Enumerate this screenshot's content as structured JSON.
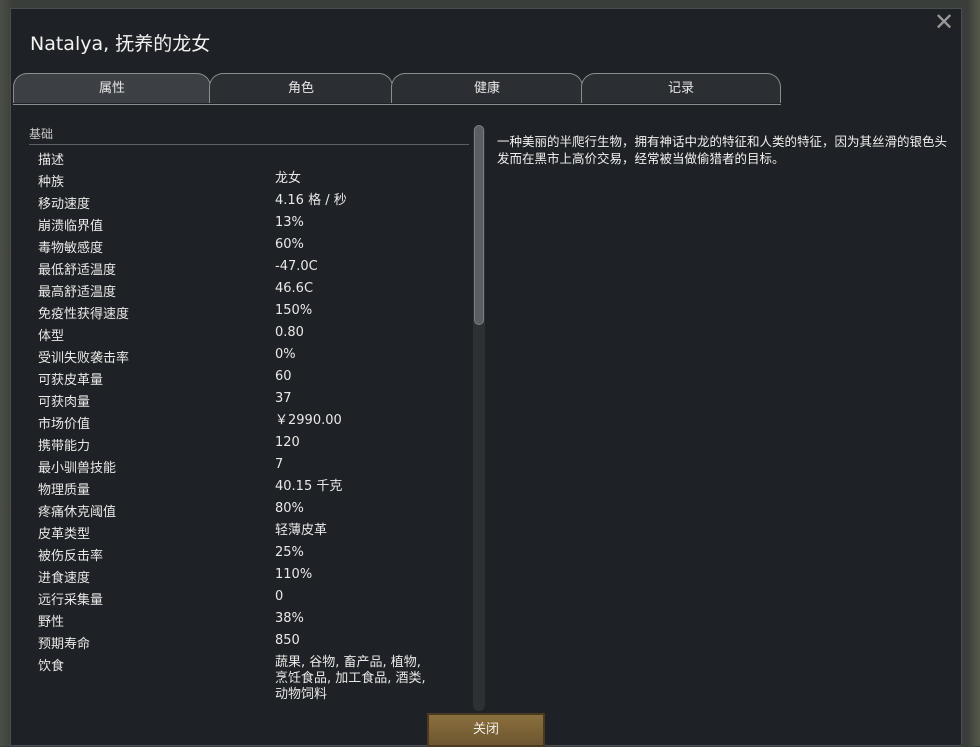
{
  "window": {
    "title": "Natalya, 抚养的龙女",
    "close_icon": "close-icon"
  },
  "tabs": [
    {
      "label": "属性",
      "active": true
    },
    {
      "label": "角色",
      "active": false
    },
    {
      "label": "健康",
      "active": false
    },
    {
      "label": "记录",
      "active": false
    }
  ],
  "stats": {
    "category": "基础",
    "rows": [
      {
        "label": "描述",
        "value": ""
      },
      {
        "label": "种族",
        "value": "龙女"
      },
      {
        "label": "移动速度",
        "value": "4.16 格 / 秒"
      },
      {
        "label": "崩溃临界值",
        "value": "13%"
      },
      {
        "label": "毒物敏感度",
        "value": "60%"
      },
      {
        "label": "最低舒适温度",
        "value": "-47.0C"
      },
      {
        "label": "最高舒适温度",
        "value": "46.6C"
      },
      {
        "label": "免疫性获得速度",
        "value": "150%"
      },
      {
        "label": "体型",
        "value": "0.80"
      },
      {
        "label": "受训失败袭击率",
        "value": "0%"
      },
      {
        "label": "可获皮革量",
        "value": "60"
      },
      {
        "label": "可获肉量",
        "value": "37"
      },
      {
        "label": "市场价值",
        "value": "￥2990.00"
      },
      {
        "label": "携带能力",
        "value": "120"
      },
      {
        "label": "最小驯兽技能",
        "value": "7"
      },
      {
        "label": "物理质量",
        "value": "40.15 千克"
      },
      {
        "label": "疼痛休克阈值",
        "value": "80%"
      },
      {
        "label": "皮革类型",
        "value": "轻薄皮革"
      },
      {
        "label": "被伤反击率",
        "value": "25%"
      },
      {
        "label": "进食速度",
        "value": "110%"
      },
      {
        "label": "远行采集量",
        "value": "0"
      },
      {
        "label": "野性",
        "value": "38%"
      },
      {
        "label": "预期寿命",
        "value": "850"
      },
      {
        "label": "饮食",
        "value": "蔬果, 谷物, 畜产品, 植物,\n烹饪食品, 加工食品, 酒类,\n动物饲料"
      }
    ]
  },
  "description": "一种美丽的半爬行生物，拥有神话中龙的特征和人类的特征，因为其丝滑的银色头发而在黑市上高价交易，经常被当做偷猎者的目标。",
  "buttons": {
    "close_label": "关闭"
  }
}
